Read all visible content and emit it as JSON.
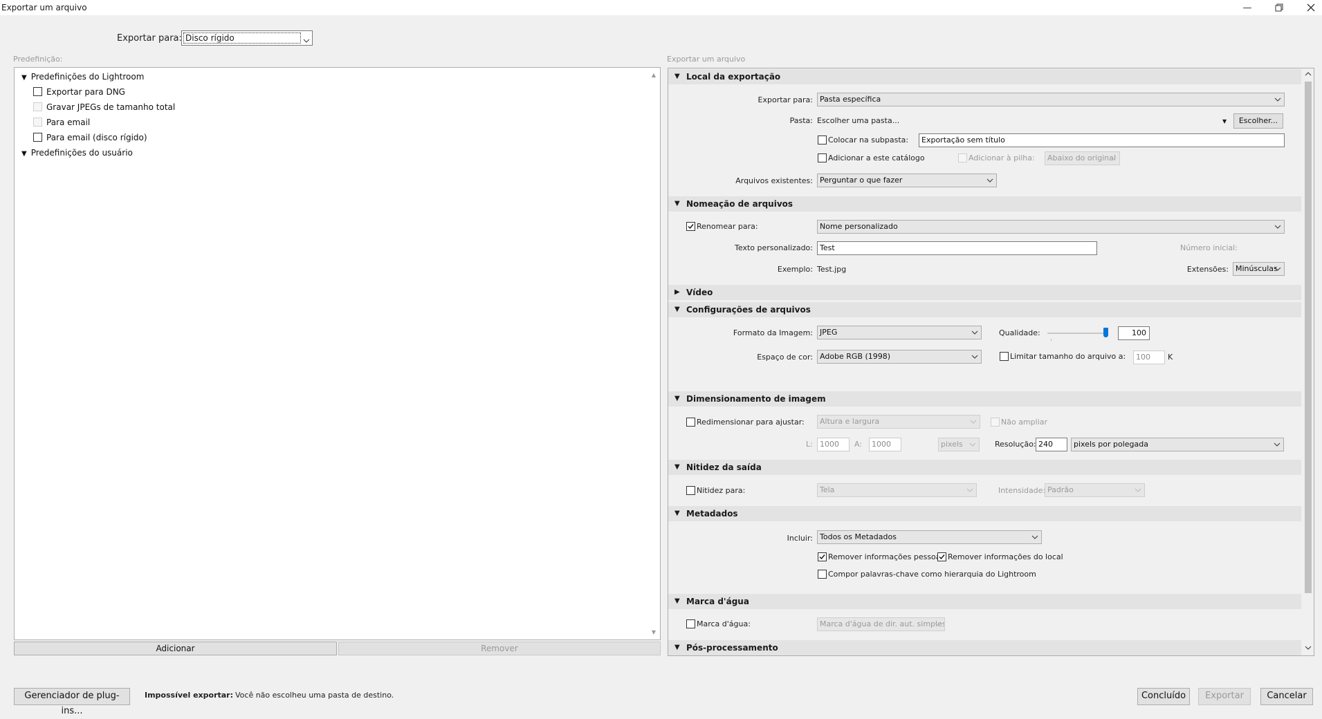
{
  "window": {
    "title": "Exportar um arquivo"
  },
  "top": {
    "export_to_label": "Exportar para:",
    "export_to_value": "Disco rígido"
  },
  "presets": {
    "heading": "Predefinição:",
    "groups": [
      {
        "label": "Predefinições do Lightroom",
        "items": [
          {
            "label": "Exportar para DNG"
          },
          {
            "label": "Gravar JPEGs de tamanho total"
          },
          {
            "label": "Para email"
          },
          {
            "label": "Para email (disco rígido)"
          }
        ]
      },
      {
        "label": "Predefinições do usuário",
        "items": []
      }
    ],
    "add_button": "Adicionar",
    "remove_button": "Remover"
  },
  "export_panel": {
    "heading": "Exportar um arquivo",
    "location": {
      "title": "Local da exportação",
      "export_to_label": "Exportar para:",
      "export_to_value": "Pasta específica",
      "folder_label": "Pasta:",
      "folder_value": "Escolher uma pasta...",
      "choose_button": "Escolher...",
      "subfolder_label": "Colocar na subpasta:",
      "subfolder_value": "Exportação sem título",
      "add_catalog_label": "Adicionar a este catálogo",
      "add_stack_label": "Adicionar à pilha:",
      "stack_value": "Abaixo do original",
      "existing_label": "Arquivos existentes:",
      "existing_value": "Perguntar o que fazer"
    },
    "naming": {
      "title": "Nomeação de arquivos",
      "rename_label": "Renomear para:",
      "rename_value": "Nome personalizado",
      "custom_text_label": "Texto personalizado:",
      "custom_text_value": "Test",
      "start_number_label": "Número inicial:",
      "example_label": "Exemplo:",
      "example_value": "Test.jpg",
      "extensions_label": "Extensões:",
      "extensions_value": "Minúsculas"
    },
    "video": {
      "title": "Vídeo"
    },
    "file_settings": {
      "title": "Configurações de arquivos",
      "format_label": "Formato da Imagem:",
      "format_value": "JPEG",
      "quality_label": "Qualidade:",
      "quality_value": "100",
      "color_space_label": "Espaço de cor:",
      "color_space_value": "Adobe RGB (1998)",
      "limit_size_label": "Limitar tamanho do arquivo a:",
      "limit_size_value": "100",
      "limit_unit": "K"
    },
    "sizing": {
      "title": "Dimensionamento de imagem",
      "resize_label": "Redimensionar para ajustar:",
      "resize_value": "Altura e largura",
      "no_enlarge_label": "Não ampliar",
      "w_label": "L:",
      "w_value": "1000",
      "h_label": "A:",
      "h_value": "1000",
      "unit_value": "pixels",
      "resolution_label": "Resolução:",
      "resolution_value": "240",
      "resolution_unit": "pixels por polegada"
    },
    "sharpening": {
      "title": "Nitidez da saída",
      "sharpen_label": "Nitidez para:",
      "sharpen_value": "Tela",
      "amount_label": "Intensidade:",
      "amount_value": "Padrão"
    },
    "metadata": {
      "title": "Metadados",
      "include_label": "Incluir:",
      "include_value": "Todos os Metadados",
      "remove_personal_label": "Remover informações pessoais",
      "remove_location_label": "Remover informações do local",
      "hierarchy_label": "Compor palavras-chave como hierarquia do Lightroom"
    },
    "watermark": {
      "title": "Marca d'água",
      "watermark_label": "Marca d'água:",
      "watermark_value": "Marca d'água de dir. aut. simples"
    },
    "post_processing": {
      "title": "Pós-processamento"
    }
  },
  "footer": {
    "plugin_button": "Gerenciador de plug-ins...",
    "error_title": "Impossível exportar:",
    "error_message": "Você não escolheu uma pasta de destino.",
    "done_button": "Concluído",
    "export_button": "Exportar",
    "cancel_button": "Cancelar"
  }
}
